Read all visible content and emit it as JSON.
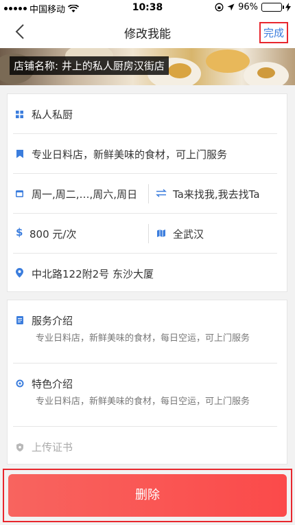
{
  "status_bar": {
    "carrier": "中国移动",
    "time": "10:38",
    "battery_percent": "96%",
    "battery_level": 0.96
  },
  "nav": {
    "title": "修改我能",
    "done_label": "完成"
  },
  "banner": {
    "store_label": "店铺名称: 井上的私人厨房汉街店"
  },
  "info_card": {
    "category": "私人私厨",
    "tagline": "专业日料店，新鲜美味的食材，可上门服务",
    "days": "周一,周二,…,周六,周日",
    "service_mode": "Ta来找我,我去找Ta",
    "price": "800 元/次",
    "area": "全武汉",
    "address": "中北路122附2号 东沙大厦"
  },
  "detail_card": {
    "service_title": "服务介绍",
    "service_desc": "专业日料店，新鲜美味的食材，每日空运，可上门服务",
    "feature_title": "特色介绍",
    "feature_desc": "专业日料店，新鲜美味的食材，每日空运，可上门服务",
    "certificate_label": "上传证书"
  },
  "delete_label": "删除",
  "colors": {
    "accent_blue": "#3b7ddd",
    "highlight_red": "#e8262d",
    "delete_button": "#fb4a4a",
    "battery_green": "#4cd964"
  },
  "icons": [
    "wifi-icon",
    "location-arrow-icon",
    "orientation-lock-icon",
    "charging-bolt-icon",
    "back-chevron-icon",
    "grid-icon",
    "bookmark-icon",
    "calendar-icon",
    "swap-arrows-icon",
    "dollar-icon",
    "map-icon",
    "location-pin-icon",
    "document-icon",
    "circle-dot-icon",
    "shield-icon"
  ]
}
